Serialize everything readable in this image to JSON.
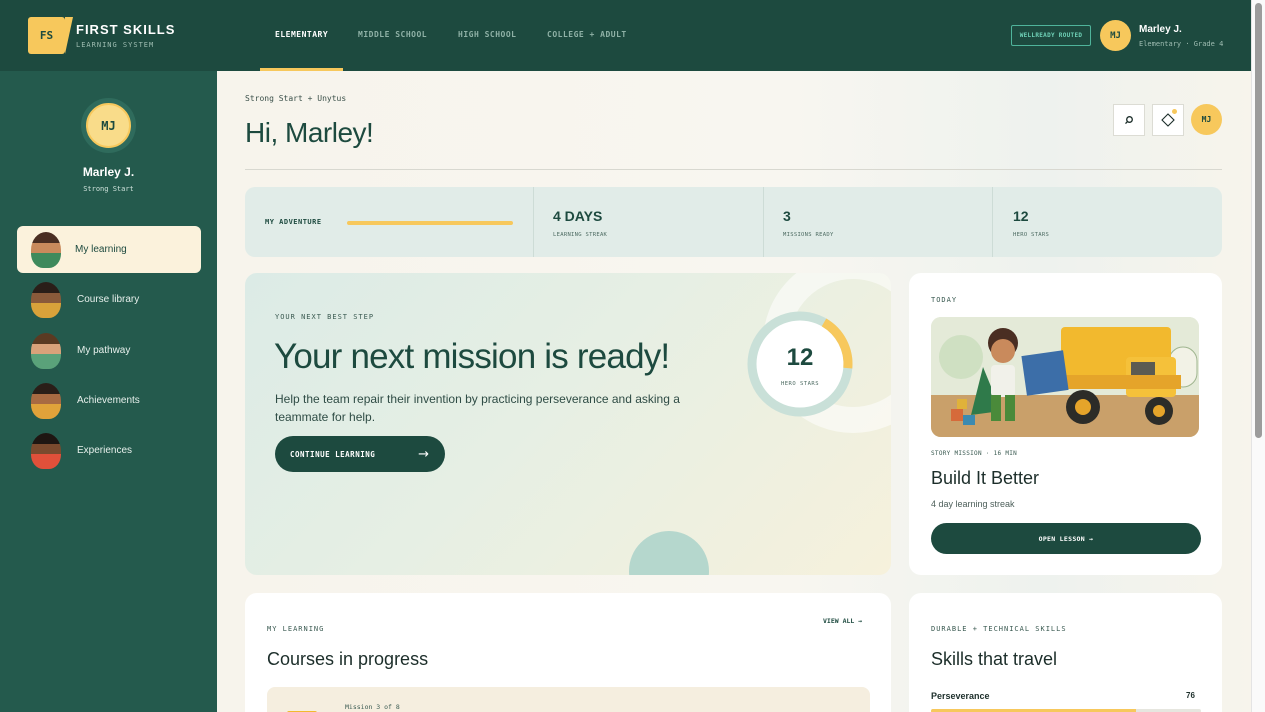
{
  "brand": {
    "badge": "FS",
    "title": "FIRST SKILLS",
    "subtitle": "LEARNING SYSTEM"
  },
  "nav": {
    "tabs": [
      {
        "label": "ELEMENTARY",
        "active": true
      },
      {
        "label": "MIDDLE SCHOOL",
        "active": false
      },
      {
        "label": "HIGH SCHOOL",
        "active": false
      },
      {
        "label": "COLLEGE + ADULT",
        "active": false
      }
    ]
  },
  "header": {
    "status_badge": "WELLREADY ROUTED",
    "avatar_initials": "MJ",
    "user_name": "Marley J.",
    "user_meta": "Elementary · Grade 4"
  },
  "sidebar": {
    "avatar_initials": "MJ",
    "name": "Marley J.",
    "subtitle": "Strong Start",
    "items": [
      {
        "label": "My learning",
        "active": true
      },
      {
        "label": "Course library",
        "active": false
      },
      {
        "label": "My pathway",
        "active": false
      },
      {
        "label": "Achievements",
        "active": false
      },
      {
        "label": "Experiences",
        "active": false
      }
    ]
  },
  "page": {
    "breadcrumb": "Strong Start + Unytus",
    "greeting": "Hi, Marley!",
    "avatar_initials": "MJ"
  },
  "stats": {
    "adventure_label": "MY ADVENTURE",
    "adventure_progress": 1.0,
    "items": [
      {
        "value": "4 DAYS",
        "label": "LEARNING STREAK"
      },
      {
        "value": "3",
        "label": "MISSIONS READY"
      },
      {
        "value": "12",
        "label": "HERO STARS"
      }
    ]
  },
  "hero": {
    "kicker": "YOUR NEXT BEST STEP",
    "title": "Your next mission is ready!",
    "text": "Help the team repair their invention by practicing perseverance and asking a teammate for help.",
    "button_label": "CONTINUE LEARNING",
    "button_arrow": "→",
    "gauge_value": "12",
    "gauge_label": "HERO STARS",
    "gauge_fraction": 0.18
  },
  "today": {
    "kicker": "TODAY",
    "meta": "STORY MISSION · 16 MIN",
    "title": "Build It Better",
    "subtitle": "4 day learning streak",
    "button_label": "OPEN LESSON →"
  },
  "courses": {
    "kicker": "MY LEARNING",
    "title": "Courses in progress",
    "view_all": "VIEW ALL →",
    "first_meta": "Mission 3 of 8"
  },
  "skills": {
    "kicker": "DURABLE + TECHNICAL SKILLS",
    "title": "Skills that travel",
    "items": [
      {
        "label": "Perseverance",
        "value": "76",
        "fraction": 0.76
      }
    ]
  },
  "colors": {
    "brand_dark": "#1d4a3f",
    "accent": "#f7c85c",
    "sidebar": "#245a4d"
  },
  "icons": {
    "search": "search-icon",
    "notify": "diamond-icon",
    "arrow": "arrow-right-icon"
  }
}
